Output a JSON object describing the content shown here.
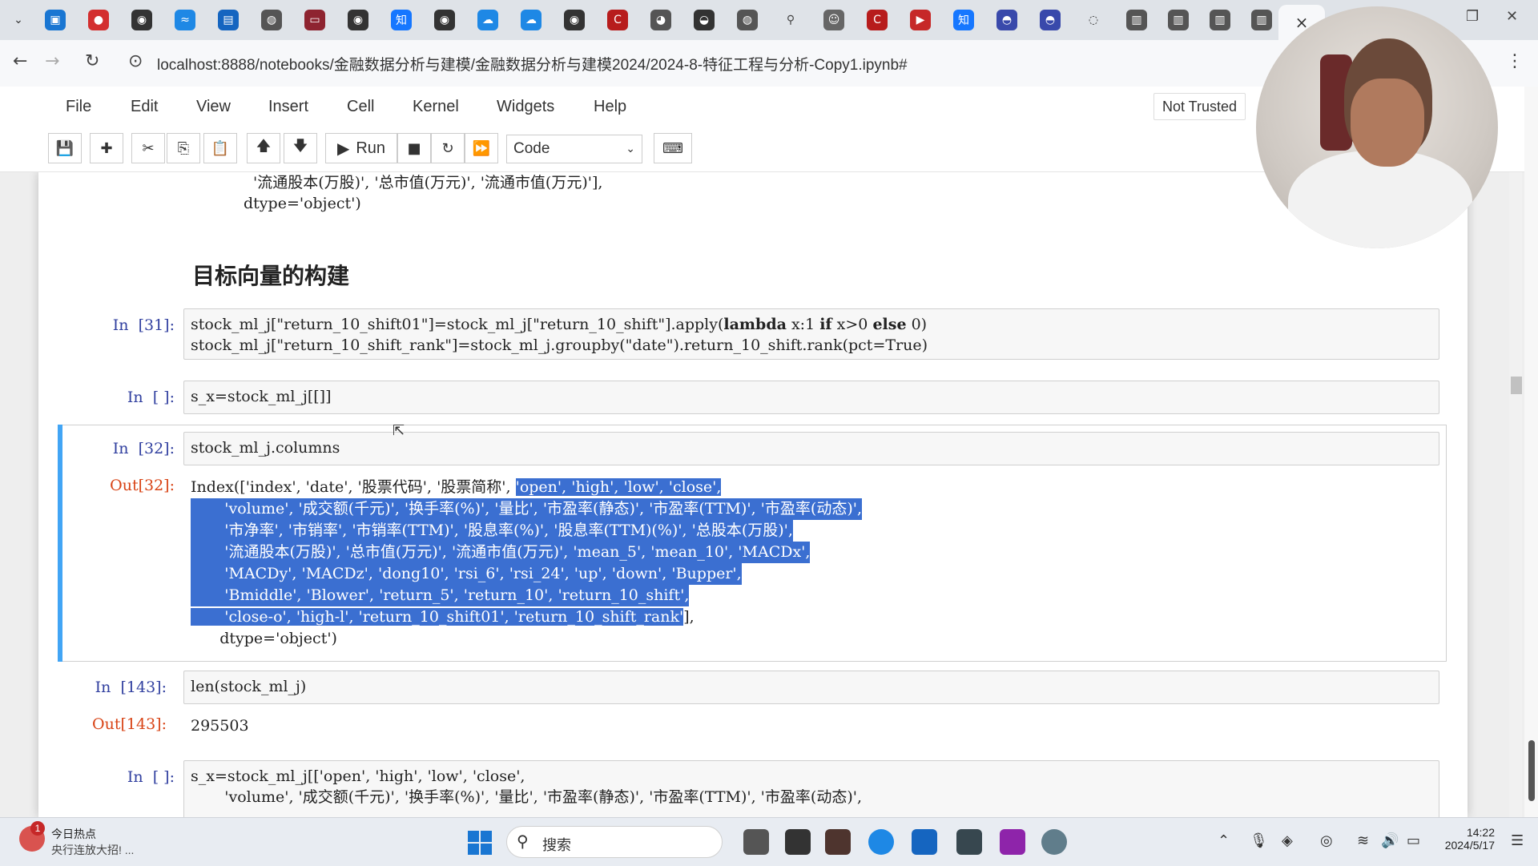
{
  "browser": {
    "url": "localhost:8888/notebooks/金融数据分析与建模/金融数据分析与建模2024/2024-8-特征工程与分析-Copy1.ipynb#",
    "active_tab_close": "×"
  },
  "menu": {
    "items": [
      "File",
      "Edit",
      "View",
      "Insert",
      "Cell",
      "Kernel",
      "Widgets",
      "Help"
    ],
    "trust_status": "Not Trusted"
  },
  "toolbar": {
    "run_label": "Run",
    "cell_type": "Code"
  },
  "notebook": {
    "prev_output_tail": [
      "'流通股本(万股)', '总市值(万元)', '流通市值(万元)'],",
      "dtype='object')"
    ],
    "heading": "目标向量的构建",
    "cells": [
      {
        "prompt": "In  [31]:",
        "code_line1_a": "stock_ml_j[\"return_10_shift01\"]=stock_ml_j[\"return_10_shift\"].apply(",
        "code_line1_kw1": "lambda",
        "code_line1_b": " x:1 ",
        "code_line1_kw2": "if",
        "code_line1_c": " x>0 ",
        "code_line1_kw3": "else",
        "code_line1_d": " 0)",
        "code_line2": "stock_ml_j[\"return_10_shift_rank\"]=stock_ml_j.groupby(\"date\").return_10_shift.rank(pct=True)"
      },
      {
        "prompt": "In  [ ]:",
        "code": "s_x=stock_ml_j[[]]"
      },
      {
        "prompt": "In  [32]:",
        "code": "stock_ml_j.columns",
        "out_prompt": "Out[32]:",
        "out_line1_a": "Index(['index', 'date', '股票代码', '股票简称', ",
        "out_line1_sel": "'open', 'high', 'low', 'close',",
        "out_lines_sel": [
          "       'volume', '成交额(千元)', '换手率(%)', '量比', '市盈率(静态)', '市盈率(TTM)', '市盈率(动态)',",
          "       '市净率', '市销率', '市销率(TTM)', '股息率(%)', '股息率(TTM)(%)', '总股本(万股)',",
          "       '流通股本(万股)', '总市值(万元)', '流通市值(万元)', 'mean_5', 'mean_10', 'MACDx',",
          "       'MACDy', 'MACDz', 'dong10', 'rsi_6', 'rsi_24', 'up', 'down', 'Bupper',",
          "       'Bmiddle', 'Blower', 'return_5', 'return_10', 'return_10_shift',"
        ],
        "out_last_sel": "       'close-o', 'high-l', 'return_10_shift01', 'return_10_shift_rank'",
        "out_last_tail": "],",
        "out_dtype": "      dtype='object')"
      },
      {
        "prompt": "In  [143]:",
        "code": "len(stock_ml_j)",
        "out_prompt": "Out[143]:",
        "out": "295503"
      },
      {
        "prompt": "In  [ ]:",
        "code_line1": "s_x=stock_ml_j[['open', 'high', 'low', 'close',",
        "code_line2": "       'volume', '成交额(千元)', '换手率(%)', '量比', '市盈率(静态)', '市盈率(TTM)', '市盈率(动态)',"
      }
    ]
  },
  "taskbar": {
    "news_badge": "1",
    "news_title": "今日热点",
    "news_sub": "央行连放大招! ...",
    "search_placeholder": "搜索",
    "time": "14:22",
    "date": "2024/5/17"
  },
  "colors": {
    "selection": "#3b6fd1",
    "prompt_in": "#303f9f",
    "prompt_out": "#d84315",
    "active_cell_bar": "#42a5f5"
  }
}
